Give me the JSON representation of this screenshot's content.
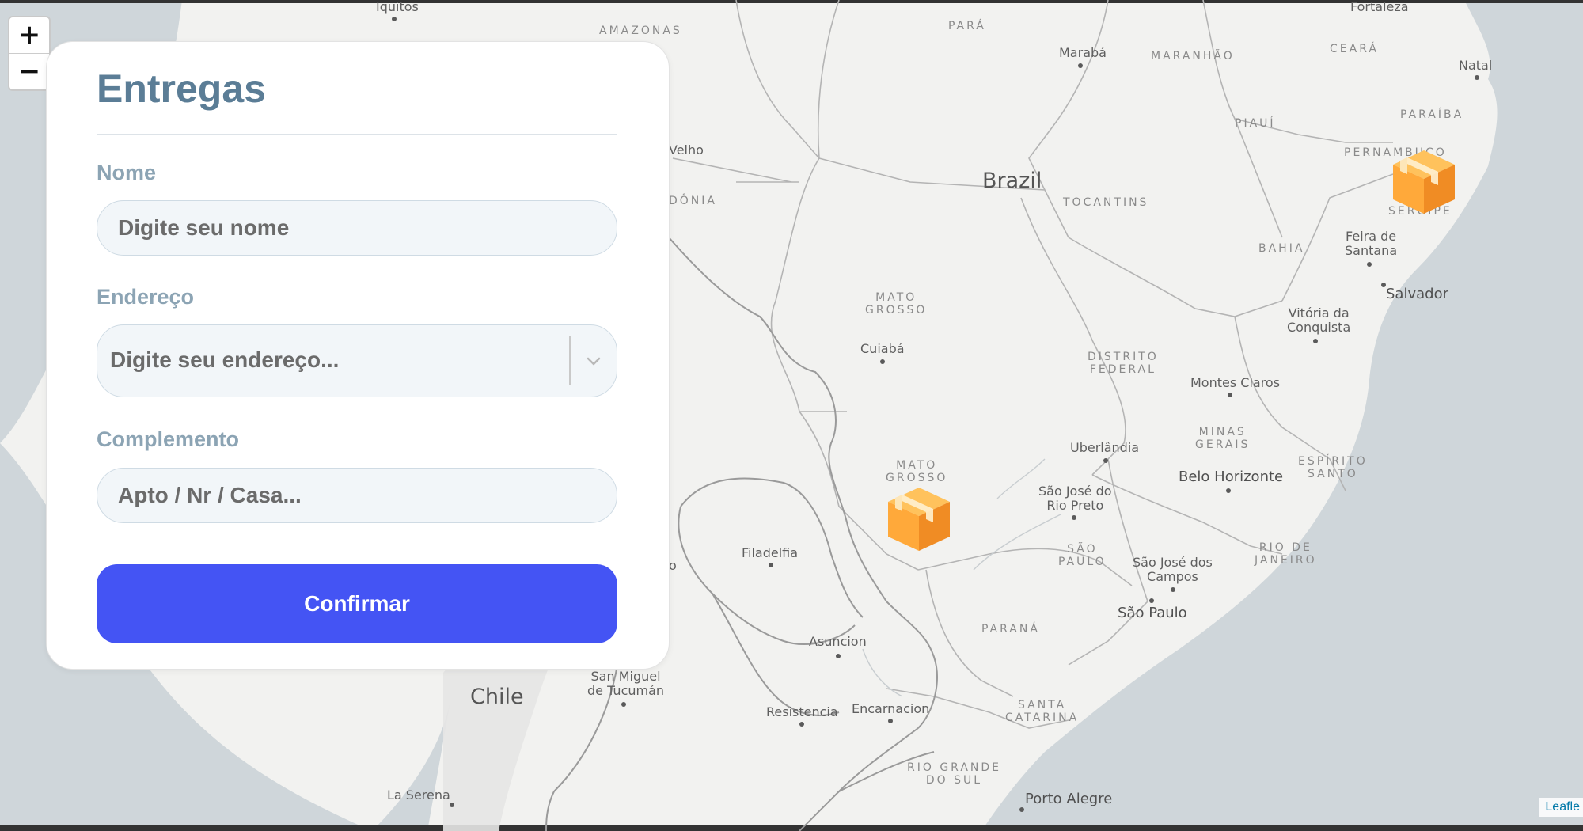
{
  "form": {
    "title": "Entregas",
    "name_label": "Nome",
    "name_placeholder": "Digite seu nome",
    "address_label": "Endereço",
    "address_placeholder": "Digite seu endereço...",
    "complement_label": "Complemento",
    "complement_placeholder": "Apto / Nr / Casa...",
    "confirm_label": "Confirmar"
  },
  "map": {
    "zoom_in": "+",
    "zoom_out": "−",
    "attribution": "Leafle",
    "marker_icon": "package-box-icon",
    "colors": {
      "land": "#f2f2f0",
      "ocean": "#cfd6da",
      "border": "#a9a9a9",
      "marker": "#f59a2c",
      "confirm": "#4454f4",
      "title": "#5b7d96"
    },
    "labels": {
      "iquitos": "Iquitos",
      "amazonas": "AMAZONAS",
      "para": "PARÁ",
      "maraba": "Marabá",
      "maranhao": "MARANHÃO",
      "fortaleza": "Fortaleza",
      "ceara": "CEARÁ",
      "natal": "Natal",
      "piaui": "PIAUÍ",
      "paraiba": "PARAÍBA",
      "pernambuco": "PERNAMBUCO",
      "velho": "Velho",
      "rondonia": "DÔNIA",
      "brazil": "Brazil",
      "tocantins": "TOCANTINS",
      "sergipe": "SERGIPE",
      "bahia": "BAHIA",
      "feira": "Feira de\nSantana",
      "salvador": "Salvador",
      "mato_grosso": "MATO\nGROSSO",
      "cuiaba": "Cuiabá",
      "distrito": "DISTRITO\nFEDERAL",
      "vitoria": "Vitória da\nConquista",
      "montes": "Montes Claros",
      "uberlandia": "Uberlândia",
      "minas": "MINAS\nGERAIS",
      "mato_grosso_sul": "MATO\nGROSSO",
      "espirito": "ESPÍRITO\nSANTO",
      "belo": "Belo Horizonte",
      "sjrp": "São José do\nRio Preto",
      "filadelfia": "Filadelfia",
      "sao_paulo_state": "SÃO\nPAULO",
      "sjc": "São José dos\nCampos",
      "rio": "RIO DE\nJANEIRO",
      "sao_paulo": "São Paulo",
      "parana": "PARANÁ",
      "asuncion": "Asuncion",
      "san_miguel": "San Miguel\nde Tucumán",
      "chile": "Chile",
      "resistencia": "Resistencia",
      "encarnacion": "Encarnacion",
      "santa_catarina": "SANTA\nCATARINA",
      "rio_grande": "RIO GRANDE\nDO SUL",
      "la_serena": "La Serena",
      "porto_alegre": "Porto Alegre",
      "o_fragment": "o"
    }
  }
}
